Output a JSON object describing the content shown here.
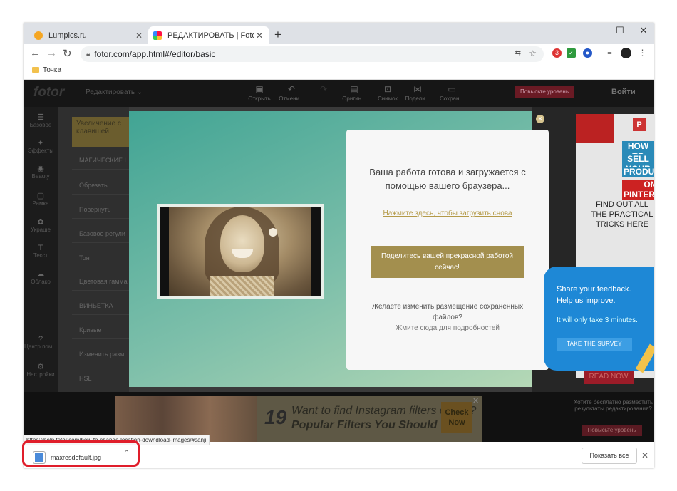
{
  "browser": {
    "tabs": [
      {
        "title": "Lumpics.ru",
        "favicon_color": "#f5a623"
      },
      {
        "title": "РЕДАКТИРОВАТЬ | Fotor",
        "favicon_color": "#e64a3c"
      }
    ],
    "new_tab": "+",
    "url": "fotor.com/app.html#/editor/basic",
    "bookmark": "Точка",
    "ext_badge": "3"
  },
  "app": {
    "logo": "fotor",
    "edit_menu": "Редактировать",
    "tools": [
      "Открыть",
      "Отмени...",
      "",
      "Оригин...",
      "Снимок",
      "Подели...",
      "Сохран..."
    ],
    "upgrade": "Повысьте уровень",
    "login": "Войти",
    "left_nav": [
      "Базовое",
      "Эффекты",
      "Beauty",
      "Рамка",
      "Украше",
      "Текст",
      "Облако",
      "Центр пом...",
      "Настройки"
    ],
    "panel_header": "Увеличение с клавишей",
    "panel_items": [
      "МАГИЧЕСКИЕ L",
      "Обрезать",
      "Повернуть",
      "Базовое регули",
      "Тон",
      "Цветовая гамма",
      "ВИНЬЕТКА",
      "Кривые",
      "Изменить разм",
      "HSL"
    ]
  },
  "modal": {
    "title": "Ваша работа готова и загружается с помощью вашего браузера...",
    "reload_link": "Нажмите здесь, чтобы загрузить снова",
    "share_button": "Поделитесь вашей прекрасной работой сейчас!",
    "question": "Желаете изменить размещение сохраненных файлов?",
    "more_link": "Жмите сюда для подробностей",
    "close": "×"
  },
  "ads": {
    "pinterest": {
      "lines": [
        "HOW TO",
        "SELL YOUR",
        "PRODUCTS",
        "ON PINTEREST?"
      ],
      "subtext": "FIND OUT ALL THE PRACTICAL TRICKS HERE",
      "read_now": "READ NOW"
    },
    "instagram": {
      "number": "19",
      "line1": "Want to find Instagram filters online?",
      "line2": "Popular Filters You Should Try",
      "check": "Check Now"
    },
    "right_bottom": "Хотите бесплатно разместить результаты редактирования?",
    "right_bottom_btn": "Повысьте уровень"
  },
  "survey": {
    "line1": "Share your feedback.",
    "line2": "Help us improve.",
    "sub": "It will only take 3 minutes.",
    "button": "TAKE THE SURVEY"
  },
  "status_url": "https://help.fotor.com/how-to-change-location-downdload-images/#sanji",
  "downloads": {
    "file": "maxresdefault.jpg",
    "show_all": "Показать все"
  }
}
